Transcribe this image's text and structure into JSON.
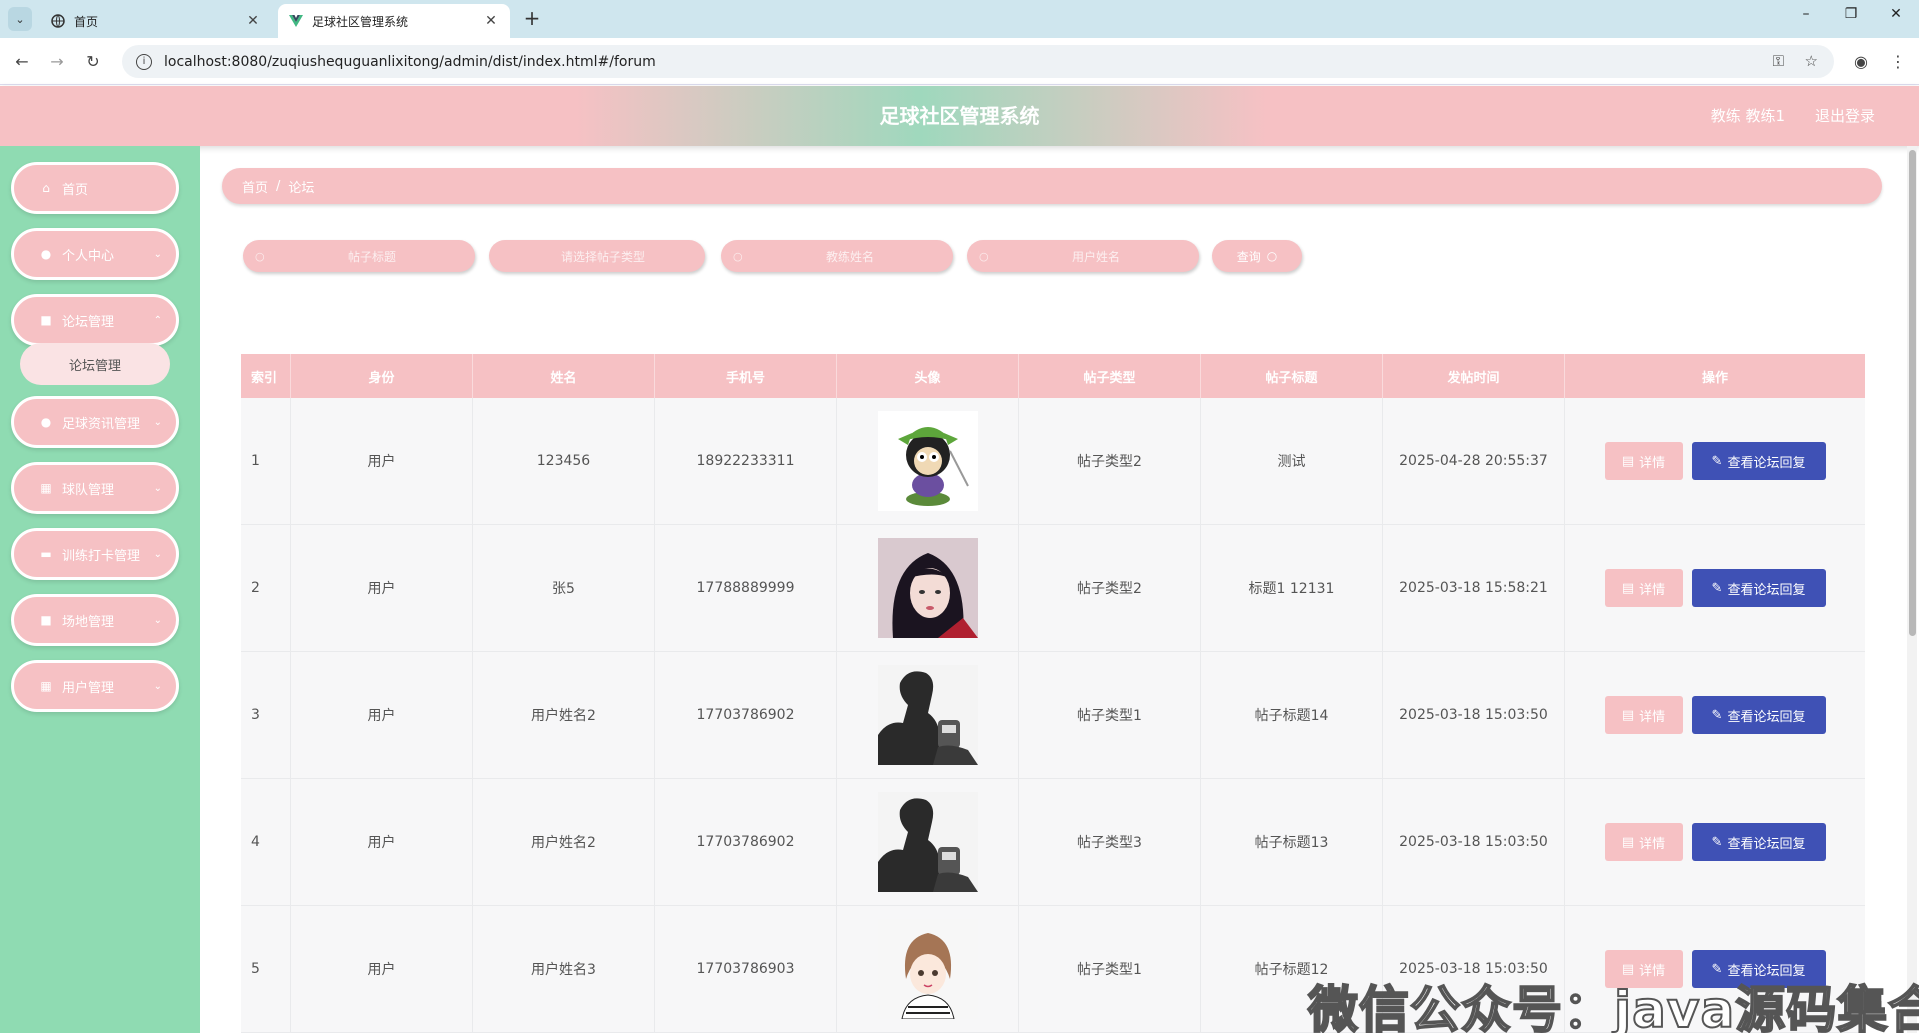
{
  "browser": {
    "tabs": [
      {
        "title": "首页",
        "active": false
      },
      {
        "title": "足球社区管理系统",
        "active": true
      }
    ],
    "url": "localhost:8080/zuqiushequguanlixitong/admin/dist/index.html#/forum"
  },
  "header": {
    "title": "足球社区管理系统",
    "user": "教练 教练1",
    "logout": "退出登录"
  },
  "sidebar": {
    "items": [
      {
        "label": "首页",
        "icon": "home-icon"
      },
      {
        "label": "个人中心",
        "icon": "user-icon"
      },
      {
        "label": "论坛管理",
        "icon": "clipboard-icon"
      },
      {
        "label": "足球资讯管理",
        "icon": "bulb-icon"
      },
      {
        "label": "球队管理",
        "icon": "grid-icon"
      },
      {
        "label": "训练打卡管理",
        "icon": "briefcase-icon"
      },
      {
        "label": "场地管理",
        "icon": "clipboard-icon"
      },
      {
        "label": "用户管理",
        "icon": "grid-icon"
      }
    ],
    "submenu": {
      "label": "论坛管理"
    }
  },
  "breadcrumb": {
    "home": "首页",
    "current": "论坛"
  },
  "search": {
    "fields": [
      {
        "placeholder": "帖子标题"
      },
      {
        "placeholder": "请选择帖子类型"
      },
      {
        "placeholder": "教练姓名"
      },
      {
        "placeholder": "用户姓名"
      }
    ],
    "button": "查询"
  },
  "table": {
    "headers": [
      "索引",
      "身份",
      "姓名",
      "手机号",
      "头像",
      "帖子类型",
      "帖子标题",
      "发帖时间",
      "操作"
    ],
    "rows": [
      {
        "index": "1",
        "role": "用户",
        "name": "123456",
        "phone": "18922233311",
        "avatar": "cartoon-avatar",
        "type": "帖子类型2",
        "title": "测试",
        "time": "2025-04-28 20:55:37"
      },
      {
        "index": "2",
        "role": "用户",
        "name": "张5",
        "phone": "17788889999",
        "avatar": "girl-photo-avatar",
        "type": "帖子类型2",
        "title": "标题1 12131",
        "time": "2025-03-18 15:58:21"
      },
      {
        "index": "3",
        "role": "用户",
        "name": "用户姓名2",
        "phone": "17703786902",
        "avatar": "silhouette-avatar",
        "type": "帖子类型1",
        "title": "帖子标题14",
        "time": "2025-03-18 15:03:50"
      },
      {
        "index": "4",
        "role": "用户",
        "name": "用户姓名2",
        "phone": "17703786902",
        "avatar": "silhouette-avatar",
        "type": "帖子类型3",
        "title": "帖子标题13",
        "time": "2025-03-18 15:03:50"
      },
      {
        "index": "5",
        "role": "用户",
        "name": "用户姓名3",
        "phone": "17703786903",
        "avatar": "sketch-girl-avatar",
        "type": "帖子类型1",
        "title": "帖子标题12",
        "time": "2025-03-18 15:03:50"
      }
    ],
    "detail_label": "详情",
    "reply_label": "查看论坛回复"
  },
  "watermark": "微信公众号：java源码集合",
  "colors": {
    "pink": "#f6c1c4",
    "green": "#8fdbb2",
    "blue": "#3f51b5"
  }
}
